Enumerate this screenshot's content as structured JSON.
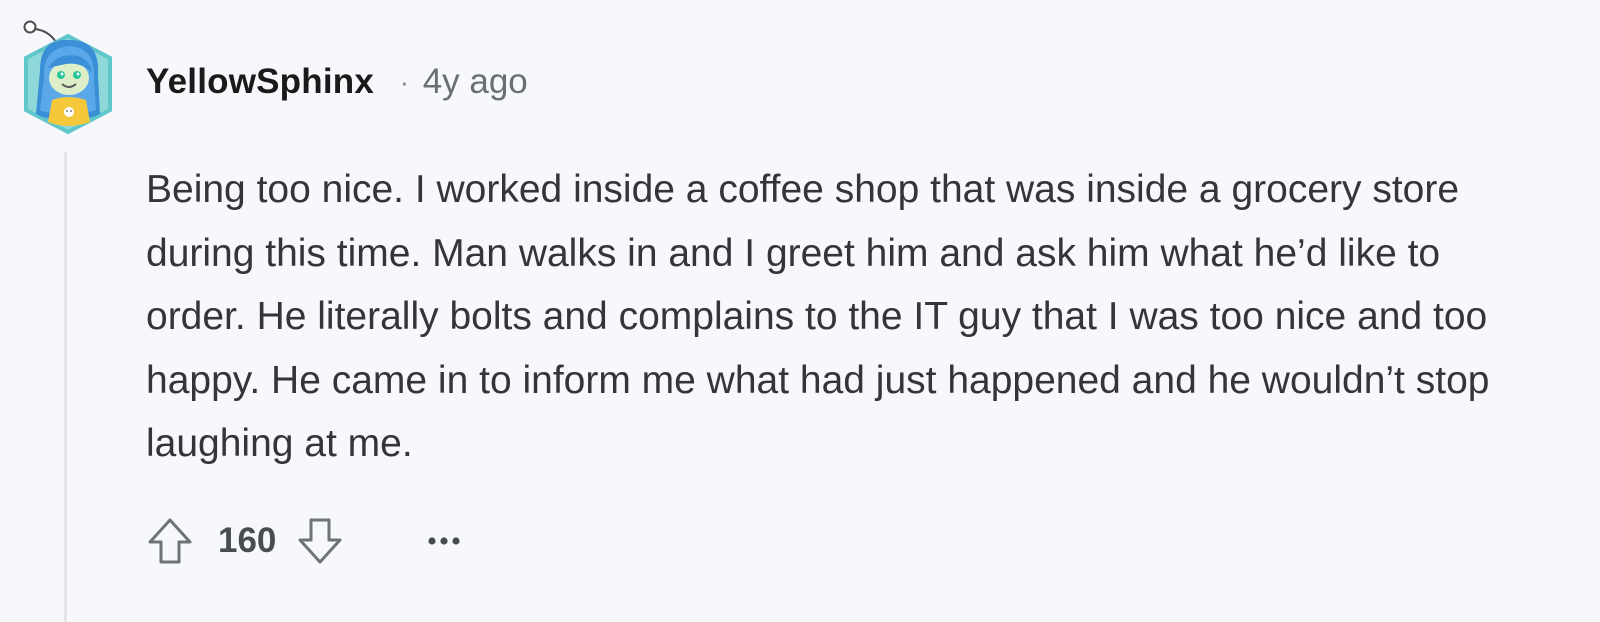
{
  "comment": {
    "author": "YellowSphinx",
    "separator": "·",
    "timestamp": "4y ago",
    "body": "Being too nice. I worked inside a coffee shop that was inside a grocery store during this time. Man walks in and I greet him and ask him what he’d like to order. He literally bolts and complains to the IT guy that I was too nice and too happy. He came in to inform me what had just happened and he wouldn’t stop laughing at me.",
    "score": "160",
    "more_label": "···"
  },
  "icons": {
    "avatar": "snoo-avatar-icon",
    "upvote": "arrow-up-icon",
    "downvote": "arrow-down-icon",
    "more": "more-options-icon"
  },
  "colors": {
    "background": "#f7f8fb",
    "avatar_hex": "#5fc6c9",
    "avatar_hair": "#3a8fd6",
    "thread_line": "#e3e5e8",
    "text": "#333538"
  }
}
